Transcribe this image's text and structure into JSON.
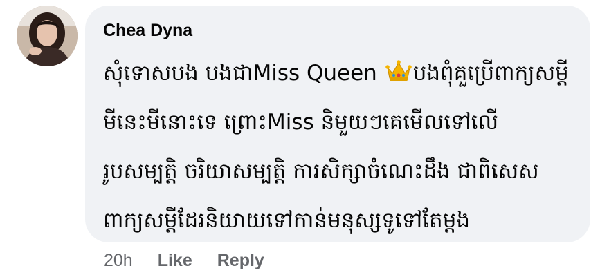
{
  "comment": {
    "author": "Chea Dyna",
    "avatar_icon": "user-photo-avatar",
    "lines": [
      {
        "before": "សុំទោសបង បងជាMiss Queen ",
        "icon": "crown-emoji",
        "after": "បងពុំគួប្រើពាក្យសម្តី"
      },
      {
        "text": "មីនេះមីនោះទេ ព្រោះMiss និមួយៗគេមើលទៅលើ"
      },
      {
        "text": "រូបសម្បត្តិ ចរិយាសម្បត្តិ ការសិក្សាចំណេះដឹង ជាពិសេស"
      },
      {
        "text": "ពាក្យសម្តីដែរនិយាយទៅកាន់មនុស្សទូទៅតែម្តង"
      }
    ]
  },
  "actions": {
    "timestamp": "20h",
    "like_label": "Like",
    "reply_label": "Reply"
  },
  "colors": {
    "bubble_background": "#f0f2f5",
    "text_primary": "#050505",
    "text_secondary": "#65676b"
  }
}
